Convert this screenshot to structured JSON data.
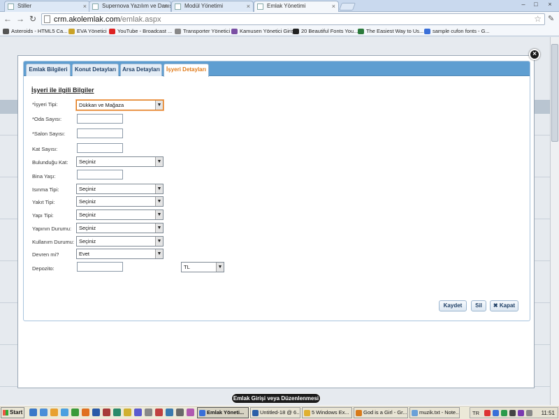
{
  "browser": {
    "tabs": [
      {
        "label": "Stiller"
      },
      {
        "label": "Supernova Yazılım ve Danışma"
      },
      {
        "label": "Modül Yönetimi"
      },
      {
        "label": "Emlak Yönetimi"
      }
    ],
    "tab_close": "×",
    "win_minimize": "–",
    "win_maximize": "□",
    "win_close": "×",
    "nav_back": "←",
    "nav_forward": "→",
    "nav_reload": "↻",
    "url_host": "crm.akolemlak.com",
    "url_path": "/emlak.aspx",
    "star": "☆",
    "wrench": "✎",
    "bookmarks": [
      {
        "label": "Asteroids - HTML5 Ca...",
        "color": "#555"
      },
      {
        "label": "EVA Yönetici",
        "color": "#c9a227"
      },
      {
        "label": "YouTube - Broadcast ...",
        "color": "#d22"
      },
      {
        "label": "Transporter Yönetici",
        "color": "#888"
      },
      {
        "label": "Kamusen Yönetici Girişi",
        "color": "#7a4fa3"
      },
      {
        "label": "20 Beautiful Fonts You...",
        "color": "#222"
      },
      {
        "label": "The Easiest Way to Us...",
        "color": "#2b7a3b"
      },
      {
        "label": "sample cufon fonts - G...",
        "color": "#3a6fd8"
      }
    ]
  },
  "modal": {
    "close_icon": "×",
    "tabs": [
      {
        "label": "Emlak Bilgileri"
      },
      {
        "label": "Konut Detayları"
      },
      {
        "label": "Arsa Detayları"
      },
      {
        "label": "İşyeri Detayları"
      }
    ],
    "section_title": "İşyeri ile ilgili Bilgiler",
    "fields": {
      "isyeri_tipi": {
        "label": "*İşyeri Tipi:",
        "value": "Dükkan ve Mağaza"
      },
      "oda_sayisi": {
        "label": "*Oda Sayısı:",
        "value": ""
      },
      "salon_sayisi": {
        "label": "*Salon Sayısı:",
        "value": ""
      },
      "kat_sayisi": {
        "label": "Kat Sayısı:",
        "value": ""
      },
      "bulundugu_kat": {
        "label": "Bulunduğu Kat:",
        "value": "Seçiniz"
      },
      "bina_yasi": {
        "label": "Bina Yaşı:",
        "value": ""
      },
      "isinma_tipi": {
        "label": "Isınma Tipi:",
        "value": "Seçiniz"
      },
      "yakit_tipi": {
        "label": "Yakıt Tipi:",
        "value": "Seçiniz"
      },
      "yapi_tipi": {
        "label": "Yapı Tipi:",
        "value": "Seçiniz"
      },
      "yapinin_durumu": {
        "label": "Yapının Durumu:",
        "value": "Seçiniz"
      },
      "kullanim_durumu": {
        "label": "Kullanım Durumu:",
        "value": "Seçiniz"
      },
      "devren_mi": {
        "label": "Devren mi?",
        "value": "Evet"
      },
      "depozito": {
        "label": "Depozito:",
        "value": "",
        "currency": "TL"
      }
    },
    "dropdown_arrow": "▼",
    "buttons": {
      "save": "Kaydet",
      "delete": "Sil",
      "close": "✖ Kapat"
    }
  },
  "status_pill": "Emlak Girişi veya Düzenlenmesi",
  "taskbar": {
    "start": "Start",
    "tasks": [
      {
        "label": "Emlak Yöneti...",
        "color": "#3a6fd8"
      },
      {
        "label": "Untitled-18 @ 6...",
        "color": "#2b5fa8"
      },
      {
        "label": "5 Windows Ex...",
        "color": "#e0b030"
      },
      {
        "label": "God is a Girl - Gr...",
        "color": "#d87a1a"
      },
      {
        "label": "muzik.txt - Note...",
        "color": "#6aa0d8"
      }
    ],
    "tray_lang": "TR",
    "clock": "11:51"
  }
}
